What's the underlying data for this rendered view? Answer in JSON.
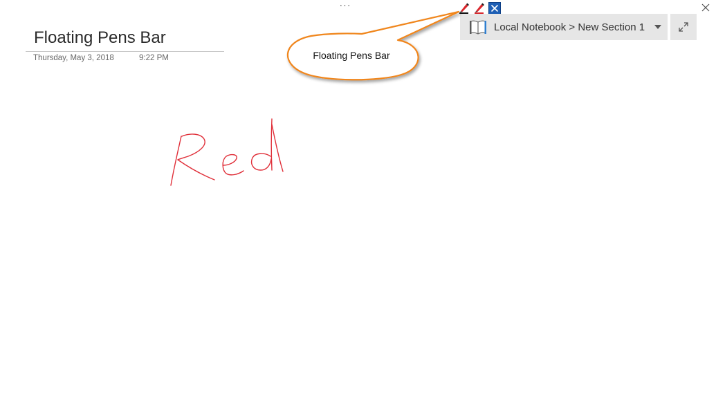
{
  "window": {
    "more_options": "···"
  },
  "pens_bar": {
    "pens": [
      {
        "icon": "black-pen-icon",
        "color": "#111111"
      },
      {
        "icon": "red-pen-icon",
        "color": "#d9262c"
      }
    ],
    "close_icon": "close-icon",
    "close_color": "#1e5fb5"
  },
  "location": {
    "notebook": "Local Notebook",
    "separator": ">",
    "section": "New Section 1",
    "text": "Local Notebook > New Section 1"
  },
  "page": {
    "title": "Floating Pens Bar",
    "date": "Thursday, May 3, 2018",
    "time": "9:22 PM"
  },
  "callout": {
    "text": "Floating Pens Bar",
    "border_color": "#f0861d"
  },
  "ink": {
    "text": "Red",
    "color": "#e0303a"
  }
}
